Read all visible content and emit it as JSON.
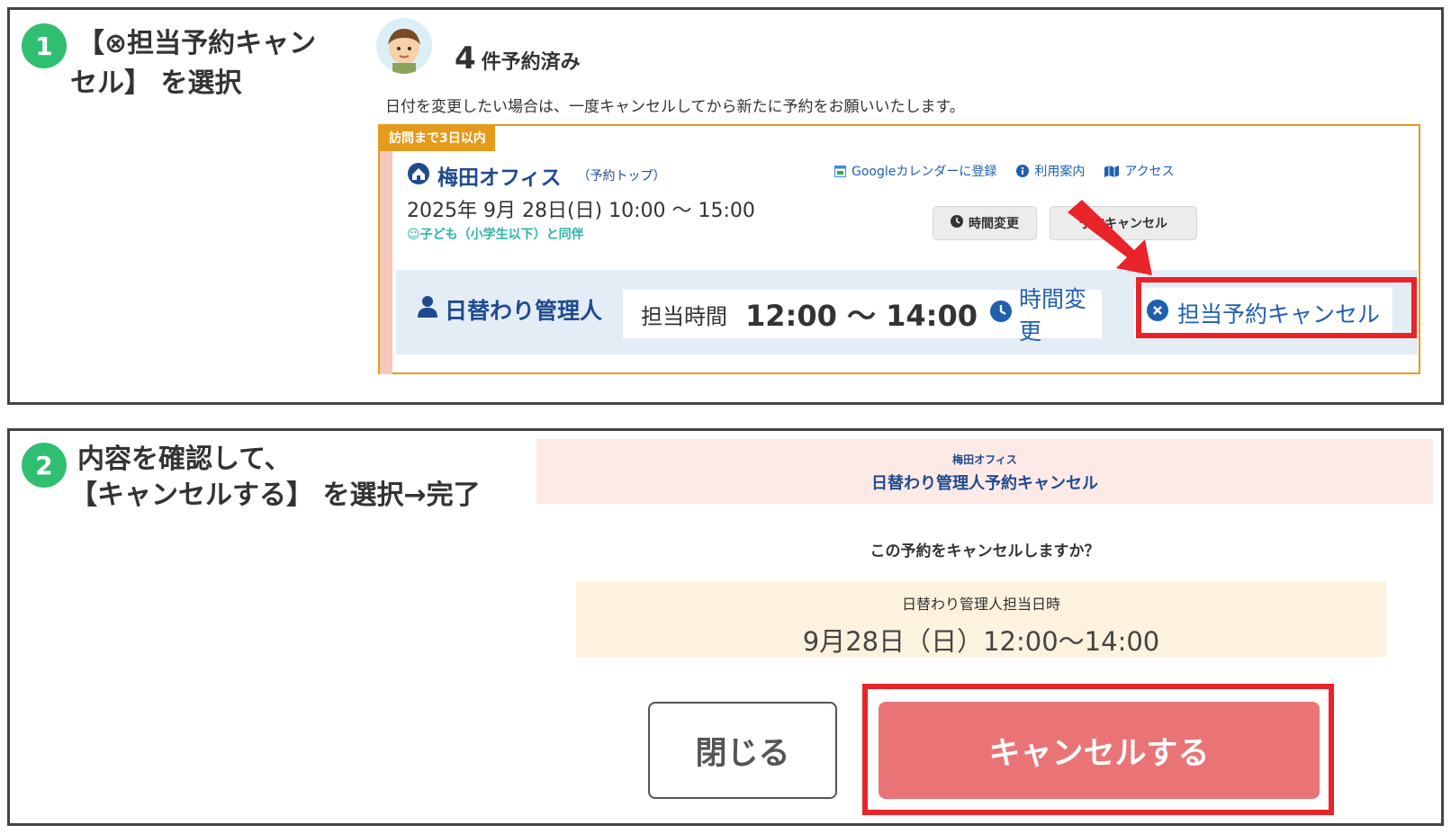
{
  "step1": {
    "number": "1",
    "line1": "【⊗担当予約キャン",
    "line2": "セル】 を選択"
  },
  "booking": {
    "count": "4",
    "count_suffix": "件予約済み",
    "note": "日付を変更したい場合は、一度キャンセルしてから新たに予約をお願いいたします。",
    "tag": "訪問まで3日以内",
    "office_name": "梅田オフィス",
    "office_top_link": "（予約トップ）",
    "links": {
      "google_calendar": "Googleカレンダーに登録",
      "guide": "利用案内",
      "access": "アクセス"
    },
    "datetime": "2025年 9月 28日(日)  10:00 〜 15:00",
    "companion": "☺子ども（小学生以下）と同伴",
    "time_change_button": "時間変更",
    "reservation_cancel_button": "予約キャンセル",
    "staff": {
      "name": "日替わり管理人",
      "time_label": "担当時間",
      "time_value": "12:00 〜 14:00",
      "time_change": "時間変更",
      "cancel": "担当予約キャンセル"
    }
  },
  "step2": {
    "number": "2",
    "line1": "内容を確認して、",
    "line2": "【キャンセルする】 を選択→完了"
  },
  "modal": {
    "office": "梅田オフィス",
    "title": "日替わり管理人予約キャンセル",
    "question": "この予約をキャンセルしますか？",
    "date_label": "日替わり管理人担当日時",
    "date_value": "9月28日（日）12:00〜14:00",
    "close_button": "閉じる",
    "cancel_button": "キャンセルする"
  },
  "colors": {
    "step_badge": "#2fbf71",
    "accent_blue": "#1f4b8e",
    "card_border": "#e59a1c",
    "highlight_red": "#e8242a",
    "cancel_button": "#ea7475"
  }
}
